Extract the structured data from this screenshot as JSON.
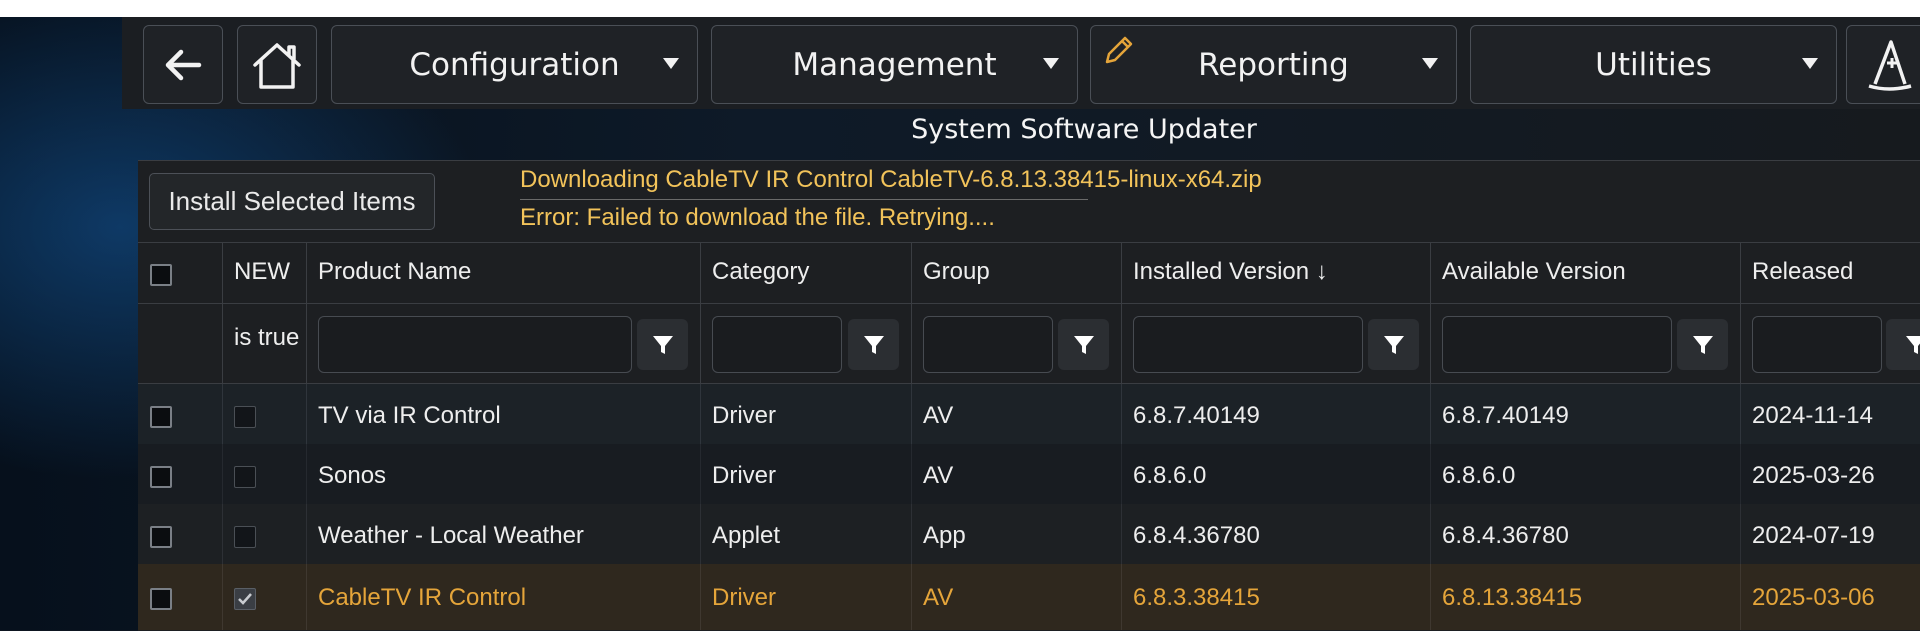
{
  "nav": {
    "menus": [
      {
        "label": "Configuration"
      },
      {
        "label": "Management"
      },
      {
        "label": "Reporting"
      },
      {
        "label": "Utilities"
      }
    ]
  },
  "page_title": "System Software Updater",
  "toolbar": {
    "install_label": "Install Selected Items",
    "status_line1": "Downloading CableTV IR Control CableTV-6.8.13.38415-linux-x64.zip",
    "status_line2": "Error: Failed to download the file. Retrying...."
  },
  "table": {
    "columns": {
      "new": "NEW",
      "product": "Product Name",
      "category": "Category",
      "group": "Group",
      "installed": "Installed Version",
      "available": "Available Version",
      "released": "Released"
    },
    "sort_indicator": "↓",
    "new_filter": "is true",
    "rows": [
      {
        "product": "TV via IR Control",
        "category": "Driver",
        "group": "AV",
        "installed": "6.8.7.40149",
        "available": "6.8.7.40149",
        "released": "2024-11-14"
      },
      {
        "product": "Sonos",
        "category": "Driver",
        "group": "AV",
        "installed": "6.8.6.0",
        "available": "6.8.6.0",
        "released": "2025-03-26"
      },
      {
        "product": "Weather - Local Weather",
        "category": "Applet",
        "group": "App",
        "installed": "6.8.4.36780",
        "available": "6.8.4.36780",
        "released": "2024-07-19"
      },
      {
        "product": "CableTV IR Control",
        "category": "Driver",
        "group": "AV",
        "installed": "6.8.3.38415",
        "available": "6.8.13.38415",
        "released": "2025-03-06"
      }
    ]
  },
  "colors": {
    "accent_orange": "#e5a53a",
    "status_yellow": "#f2c35a"
  },
  "icons": {
    "back": "back-arrow-icon",
    "home": "home-icon",
    "reporting": "pencil-icon",
    "wizard": "wizard-hat-icon",
    "filter": "filter-icon",
    "check": "checkmark-icon"
  }
}
